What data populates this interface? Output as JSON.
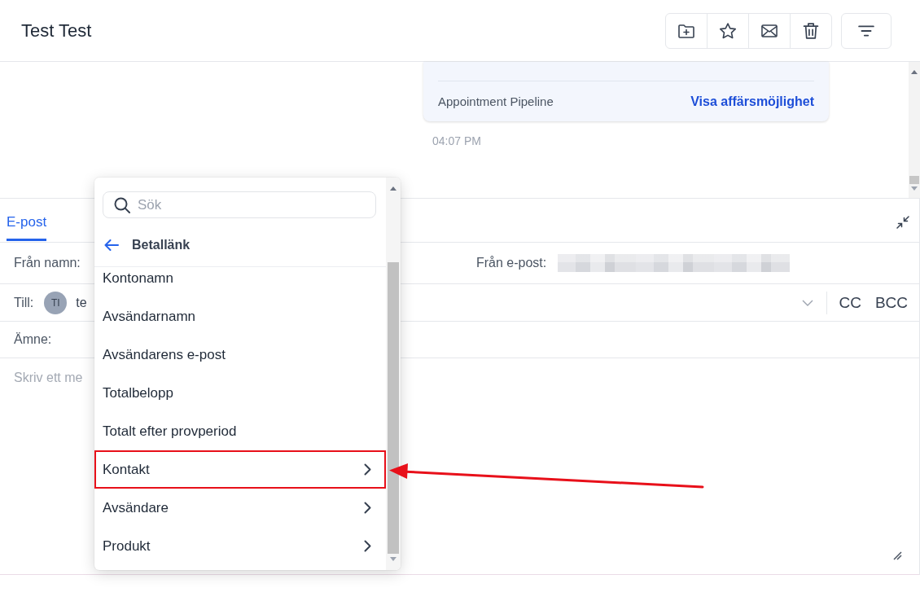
{
  "header": {
    "title": "Test Test"
  },
  "conversation": {
    "card": {
      "pipeline": "Appointment Pipeline",
      "link": "Visa affärsmöjlighet"
    },
    "time": "04:07 PM"
  },
  "compose": {
    "tabs": [
      {
        "label": "E-post",
        "selected": true
      }
    ],
    "from_name": {
      "label": "Från namn:"
    },
    "from_email": {
      "label": "Från e-post:",
      "redacted": true
    },
    "to": {
      "label": "Till:",
      "recipient_initials": "TI",
      "recipient": "te",
      "cc": "CC",
      "bcc": "BCC"
    },
    "subject": {
      "label": "Ämne:"
    },
    "body": {
      "placeholder": "Skriv ett me"
    }
  },
  "dropdown": {
    "search": {
      "placeholder": "Sök"
    },
    "back_label": "Betallänk",
    "items": [
      {
        "label": "Kontonamn",
        "kind": "field",
        "highlighted": false
      },
      {
        "label": "Avsändarnamn",
        "kind": "field",
        "highlighted": false
      },
      {
        "label": "Avsändarens e-post",
        "kind": "field",
        "highlighted": false
      },
      {
        "label": "Totalbelopp",
        "kind": "field",
        "highlighted": false
      },
      {
        "label": "Totalt efter provperiod",
        "kind": "field",
        "highlighted": false
      },
      {
        "label": "Kontakt",
        "kind": "submenu",
        "highlighted": true
      },
      {
        "label": "Avsändare",
        "kind": "submenu",
        "highlighted": false
      },
      {
        "label": "Produkt",
        "kind": "submenu",
        "highlighted": false
      }
    ]
  }
}
